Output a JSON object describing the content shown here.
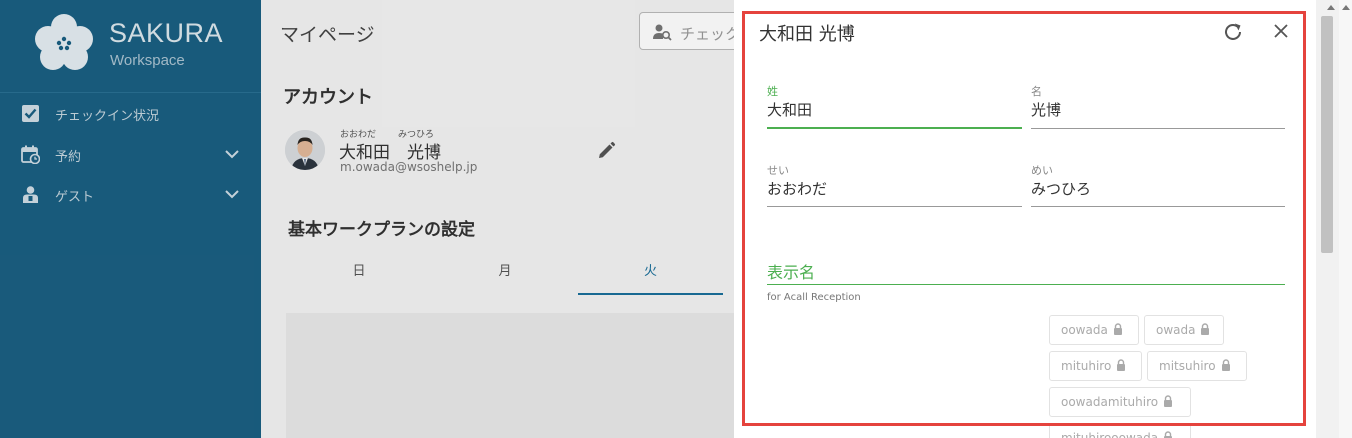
{
  "brand": {
    "name": "SAKURA",
    "sub": "Workspace"
  },
  "sidebar": {
    "items": [
      {
        "label": "チェックイン状況",
        "icon": "checkbox-icon"
      },
      {
        "label": "予約",
        "icon": "calendar-icon"
      },
      {
        "label": "ゲスト",
        "icon": "guest-icon"
      }
    ]
  },
  "main": {
    "title": "マイページ",
    "search_text": "チェック",
    "account_title": "アカウント",
    "ruby_last": "おおわだ",
    "ruby_first": "みつひろ",
    "full_name": "大和田　光博",
    "email": "m.owada@wsoshelp.jp",
    "workplan_title": "基本ワークプランの設定",
    "tabs": [
      "日",
      "月",
      "火"
    ]
  },
  "dialog": {
    "title": "大和田 光博",
    "last_name_label": "姓",
    "last_name": "大和田",
    "first_name_label": "名",
    "first_name": "光博",
    "last_kana_label": "せい",
    "last_kana": "おおわだ",
    "first_kana_label": "めい",
    "first_kana": "みつひろ",
    "display_name_label": "表示名",
    "display_name_hint": "for Acall Reception",
    "chips": [
      "oowada",
      "owada",
      "mituhiro",
      "mitsuhiro",
      "oowadamituhiro",
      "mituhirooowada"
    ]
  },
  "colors": {
    "sidebar": "#1a5f82",
    "accent": "#1a6f9a",
    "active_field": "#4caf50",
    "highlight": "#e5433d"
  }
}
